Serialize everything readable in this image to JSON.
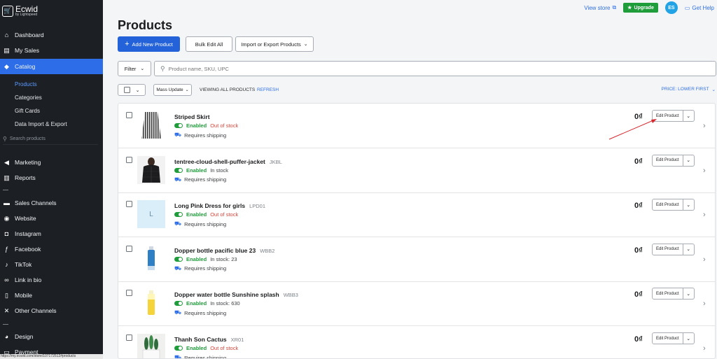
{
  "sidebar": {
    "brand": "Ecwid",
    "brand_sub": "by Lightspeed",
    "nav": [
      {
        "label": "Dashboard",
        "icon": "home-icon",
        "glyph": "⌂"
      },
      {
        "label": "My Sales",
        "icon": "sales-icon",
        "glyph": "▤"
      },
      {
        "label": "Catalog",
        "icon": "tag-icon",
        "glyph": "◆"
      }
    ],
    "catalog_sub": [
      "Products",
      "Categories",
      "Gift Cards",
      "Data Import & Export"
    ],
    "search_placeholder": "Search products",
    "nav2": [
      {
        "label": "Marketing",
        "icon": "megaphone-icon",
        "glyph": "◀"
      },
      {
        "label": "Reports",
        "icon": "chart-icon",
        "glyph": "▥"
      }
    ],
    "nav3": [
      {
        "label": "Sales Channels",
        "icon": "channels-icon",
        "glyph": "▬"
      },
      {
        "label": "Website",
        "icon": "globe-icon",
        "glyph": "◉"
      },
      {
        "label": "Instagram",
        "icon": "instagram-icon",
        "glyph": "◘"
      },
      {
        "label": "Facebook",
        "icon": "facebook-icon",
        "glyph": "ƒ"
      },
      {
        "label": "TikTok",
        "icon": "tiktok-icon",
        "glyph": "♪"
      },
      {
        "label": "Link in bio",
        "icon": "link-icon",
        "glyph": "∞"
      },
      {
        "label": "Mobile",
        "icon": "mobile-icon",
        "glyph": "▯"
      },
      {
        "label": "Other Channels",
        "icon": "plug-icon",
        "glyph": "✕"
      }
    ],
    "nav4": [
      {
        "label": "Design",
        "icon": "palette-icon",
        "glyph": "◕"
      },
      {
        "label": "Payment",
        "icon": "wallet-icon",
        "glyph": "▭"
      }
    ],
    "status_url": "https://my.ecwid.com/store/107172512#products"
  },
  "topbar": {
    "view_store": "View store",
    "upgrade": "Upgrade",
    "avatar": "ES",
    "help": "Get Help"
  },
  "page": {
    "title": "Products",
    "add_new": "Add New Product",
    "bulk_edit": "Bulk Edit All",
    "import_export": "Import or Export Products",
    "filter": "Filter",
    "search_placeholder": "Product name, SKU, UPC",
    "mass_update": "Mass Update",
    "viewing": "VIEWING ALL PRODUCTS",
    "refresh": "REFRESH",
    "sort": "PRICE: LOWER FIRST"
  },
  "products": [
    {
      "name": "Striped Skirt",
      "sku": "",
      "status": "Enabled",
      "stock": "Out of stock",
      "stock_kind": "oos",
      "shipping": "Requires shipping",
      "price": "0₫",
      "edit": "Edit Product",
      "thumb": "skirt"
    },
    {
      "name": "tentree-cloud-shell-puffer-jacket",
      "sku": "JKBL",
      "status": "Enabled",
      "stock": "In stock",
      "stock_kind": "in",
      "shipping": "Requires shipping",
      "price": "0₫",
      "edit": "Edit Product",
      "thumb": "jacket"
    },
    {
      "name": "Long Pink Dress for girls",
      "sku": "LPD01",
      "status": "Enabled",
      "stock": "Out of stock",
      "stock_kind": "oos",
      "shipping": "Requires shipping",
      "price": "0₫",
      "edit": "Edit Product",
      "thumb": "letter",
      "thumb_letter": "L"
    },
    {
      "name": "Dopper bottle pacific blue 23",
      "sku": "WBB2",
      "status": "Enabled",
      "stock": "In stock: 23",
      "stock_kind": "in",
      "shipping": "Requires shipping",
      "price": "0₫",
      "edit": "Edit Product",
      "thumb": "bottle-blue"
    },
    {
      "name": "Dopper water bottle Sunshine splash",
      "sku": "WBB3",
      "status": "Enabled",
      "stock": "In stock: 630",
      "stock_kind": "in",
      "shipping": "Requires shipping",
      "price": "0₫",
      "edit": "Edit Product",
      "thumb": "bottle-yellow"
    },
    {
      "name": "Thanh Son Cactus",
      "sku": "XR01",
      "status": "Enabled",
      "stock": "Out of stock",
      "stock_kind": "oos",
      "shipping": "Requires shipping",
      "price": "0₫",
      "edit": "Edit Product",
      "thumb": "cactus"
    }
  ],
  "colors": {
    "primary": "#2462d9",
    "sidebar": "#1c1f24",
    "enabled": "#1f9d3b",
    "out_of_stock": "#d9453a",
    "annotation_arrow": "#d7282f"
  }
}
